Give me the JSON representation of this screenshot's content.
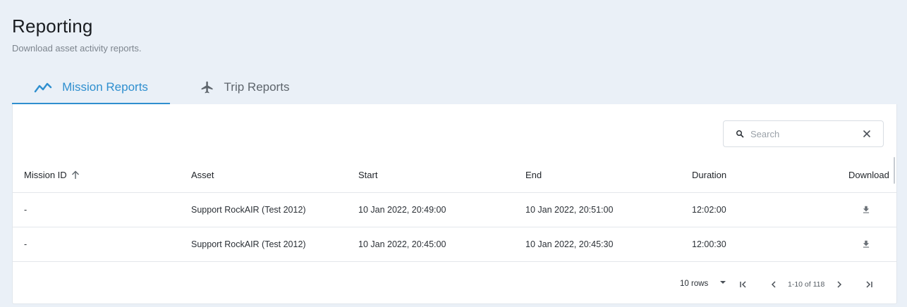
{
  "header": {
    "title": "Reporting",
    "subtitle": "Download asset activity reports."
  },
  "tabs": [
    {
      "label": "Mission Reports",
      "icon": "trend-line-icon",
      "active": true
    },
    {
      "label": "Trip Reports",
      "icon": "airplane-icon",
      "active": false
    }
  ],
  "search": {
    "placeholder": "Search",
    "value": ""
  },
  "table": {
    "columns": [
      "Mission ID",
      "Asset",
      "Start",
      "End",
      "Duration",
      "Download"
    ],
    "sort_column": "Mission ID",
    "sort_direction": "ascending",
    "rows": [
      {
        "mission_id": "-",
        "asset": "Support RockAIR (Test 2012)",
        "start": "10 Jan 2022, 20:49:00",
        "end": "10 Jan 2022, 20:51:00",
        "duration": "12:02:00"
      },
      {
        "mission_id": "-",
        "asset": "Support RockAIR (Test 2012)",
        "start": "10 Jan 2022, 20:45:00",
        "end": "10 Jan 2022, 20:45:30",
        "duration": "12:00:30"
      }
    ]
  },
  "pagination": {
    "rows_per_page": "10 rows",
    "range": "1-10 of 118"
  },
  "colors": {
    "accent": "#2f8fcf",
    "background": "#eaf0f7",
    "card": "#ffffff"
  }
}
